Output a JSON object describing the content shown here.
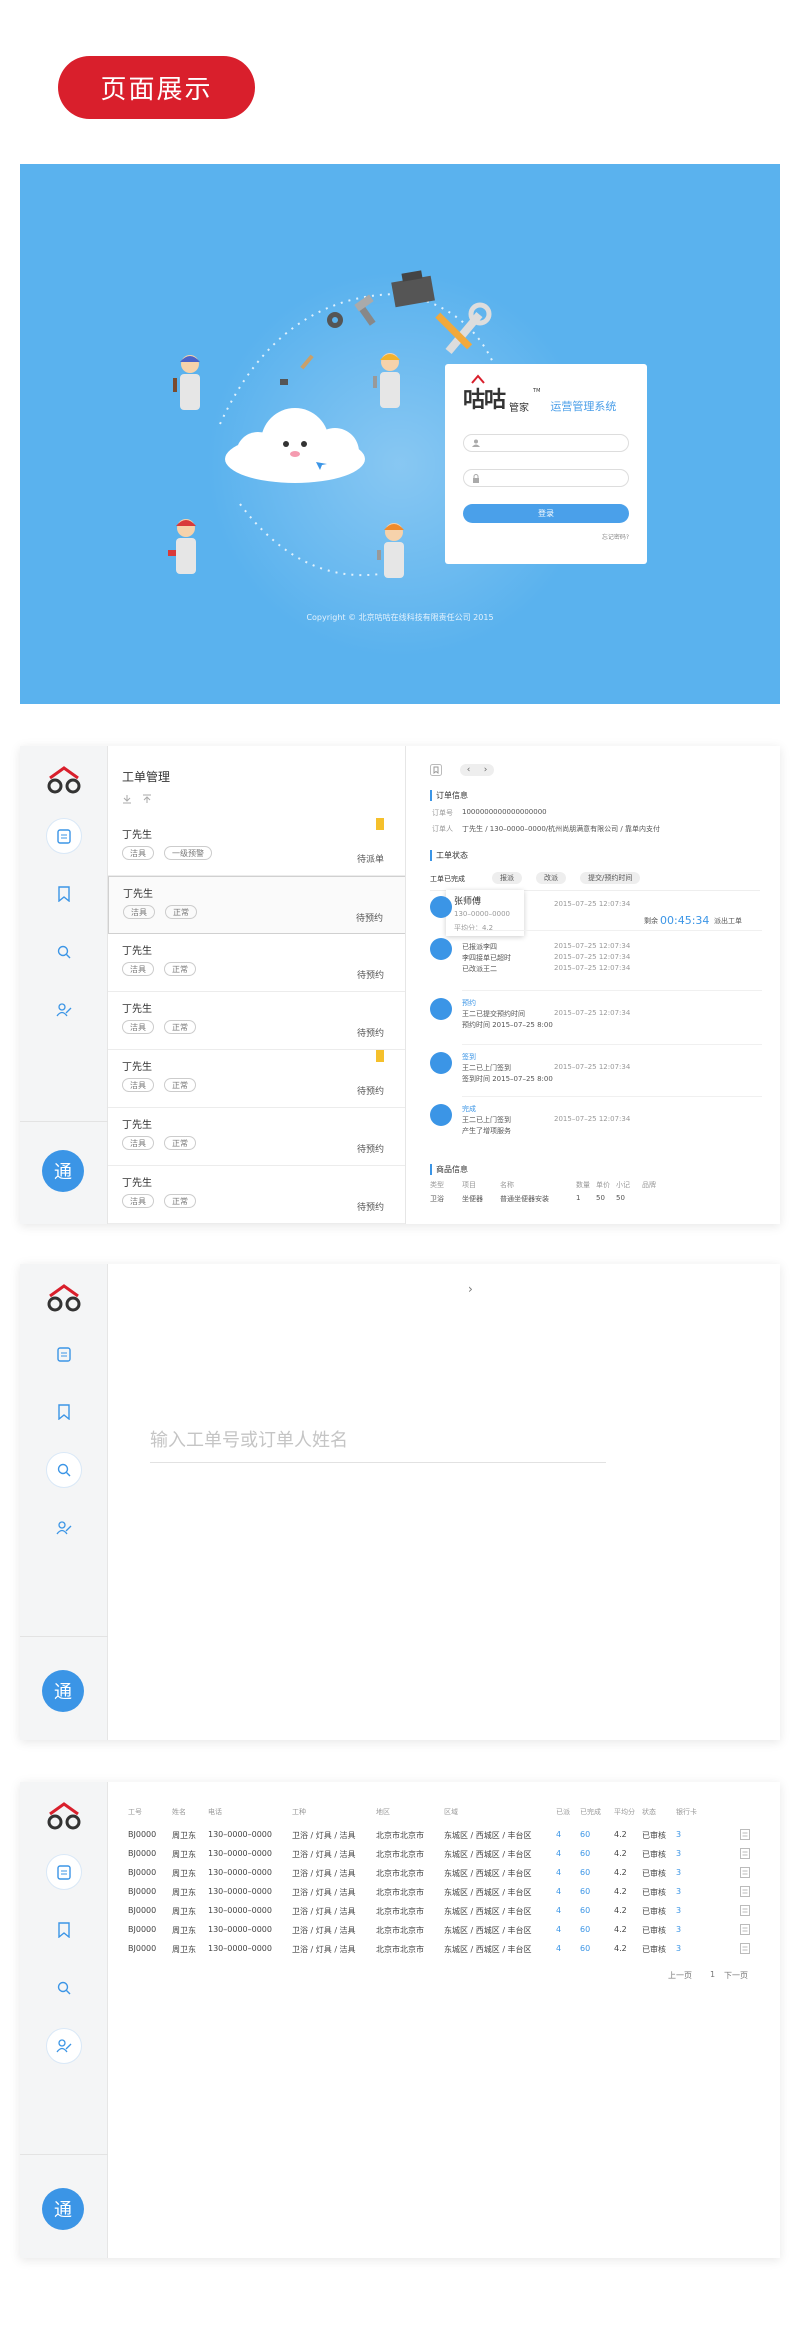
{
  "header": {
    "title": "页面展示"
  },
  "login": {
    "brand": "咕咕",
    "brand_sub": "管家",
    "tm": "TM",
    "system_name": "运营管理系统",
    "login_button": "登录",
    "forgot": "忘记密码?",
    "copyright": "Copyright © 北京咕咕在线科技有限责任公司 2015"
  },
  "sidebar": {
    "tong": "通"
  },
  "workorders": {
    "title": "工单管理",
    "items": [
      {
        "name": "丁先生",
        "tag1": "洁具",
        "tag2": "一级预警",
        "status": "待派单",
        "bookmark": true
      },
      {
        "name": "丁先生",
        "tag1": "洁具",
        "tag2": "正常",
        "status": "待预约",
        "bookmark": false
      },
      {
        "name": "丁先生",
        "tag1": "洁具",
        "tag2": "正常",
        "status": "待预约",
        "bookmark": false
      },
      {
        "name": "丁先生",
        "tag1": "洁具",
        "tag2": "正常",
        "status": "待预约",
        "bookmark": false
      },
      {
        "name": "丁先生",
        "tag1": "洁具",
        "tag2": "正常",
        "status": "待预约",
        "bookmark": true
      },
      {
        "name": "丁先生",
        "tag1": "洁具",
        "tag2": "正常",
        "status": "待预约",
        "bookmark": false
      },
      {
        "name": "丁先生",
        "tag1": "洁具",
        "tag2": "正常",
        "status": "待预约",
        "bookmark": false
      }
    ]
  },
  "detail": {
    "order_info_title": "订单信息",
    "order_no_label": "订单号",
    "order_no": "1000000000000000000",
    "customer_label": "订单人",
    "customer": "丁先生 / 130–0000–0000/杭州尚朋满意有限公司 / 靠单内支付",
    "status_title": "工单状态",
    "tabs": [
      "工单已完成",
      "报派",
      "改派",
      "提交/预约时间"
    ],
    "popup": {
      "name": "张师傅",
      "phone": "130–0000–0000",
      "score": "平均分：4.2"
    },
    "remain_label": "剩余",
    "remain_time": "00:45:34",
    "remain_suffix": "派出工单",
    "timeline": [
      {
        "lines": [
          {
            "text": "",
            "time": "2015–07–25 12:07:34"
          }
        ]
      },
      {
        "lines": [
          {
            "text": "已报派李四",
            "time": "2015–07–25 12:07:34"
          },
          {
            "text": "李四接单已超时",
            "time": "2015–07–25 12:07:34"
          },
          {
            "text": "已改派王二",
            "time": "2015–07–25 12:07:34"
          }
        ]
      },
      {
        "title": "预约",
        "lines": [
          {
            "text": "王二已提交预约时间",
            "time": "2015–07–25 12:07:34"
          },
          {
            "text": "预约时间 2015–07–25 8:00",
            "time": ""
          }
        ]
      },
      {
        "title": "签到",
        "lines": [
          {
            "text": "王二已上门签到",
            "time": "2015–07–25 12:07:34"
          },
          {
            "text": "签到时间 2015–07–25 8:00",
            "time": ""
          }
        ]
      },
      {
        "title": "完成",
        "lines": [
          {
            "text": "王二已上门签到",
            "time": "2015–07–25 12:07:34"
          },
          {
            "text": "产生了增项服务",
            "time": ""
          }
        ]
      }
    ],
    "goods_title": "商品信息",
    "goods_headers": [
      "类型",
      "项目",
      "名称",
      "数量",
      "单价",
      "小记",
      "品牌"
    ],
    "goods_row": [
      "卫浴",
      "坐便器",
      "普通坐便器安装",
      "1",
      "50",
      "50",
      ""
    ]
  },
  "search": {
    "placeholder": "输入工单号或订单人姓名",
    "chevron": "›"
  },
  "table": {
    "headers": [
      "工号",
      "姓名",
      "电话",
      "工种",
      "地区",
      "区域",
      "已派",
      "已完成",
      "平均分",
      "状态",
      "银行卡"
    ],
    "rows": [
      [
        "BJ0000",
        "周卫东",
        "130–0000–0000",
        "卫浴 / 灯具 / 洁具",
        "北京市北京市",
        "东城区 / 西城区 / 丰台区",
        "4",
        "60",
        "4.2",
        "已审核",
        "3"
      ],
      [
        "BJ0000",
        "周卫东",
        "130–0000–0000",
        "卫浴 / 灯具 / 洁具",
        "北京市北京市",
        "东城区 / 西城区 / 丰台区",
        "4",
        "60",
        "4.2",
        "已审核",
        "3"
      ],
      [
        "BJ0000",
        "周卫东",
        "130–0000–0000",
        "卫浴 / 灯具 / 洁具",
        "北京市北京市",
        "东城区 / 西城区 / 丰台区",
        "4",
        "60",
        "4.2",
        "已审核",
        "3"
      ],
      [
        "BJ0000",
        "周卫东",
        "130–0000–0000",
        "卫浴 / 灯具 / 洁具",
        "北京市北京市",
        "东城区 / 西城区 / 丰台区",
        "4",
        "60",
        "4.2",
        "已审核",
        "3"
      ],
      [
        "BJ0000",
        "周卫东",
        "130–0000–0000",
        "卫浴 / 灯具 / 洁具",
        "北京市北京市",
        "东城区 / 西城区 / 丰台区",
        "4",
        "60",
        "4.2",
        "已审核",
        "3"
      ],
      [
        "BJ0000",
        "周卫东",
        "130–0000–0000",
        "卫浴 / 灯具 / 洁具",
        "北京市北京市",
        "东城区 / 西城区 / 丰台区",
        "4",
        "60",
        "4.2",
        "已审核",
        "3"
      ],
      [
        "BJ0000",
        "周卫东",
        "130–0000–0000",
        "卫浴 / 灯具 / 洁具",
        "北京市北京市",
        "东城区 / 西城区 / 丰台区",
        "4",
        "60",
        "4.2",
        "已审核",
        "3"
      ]
    ],
    "pager": {
      "prev": "上一页",
      "page": "1",
      "next": "下一页"
    }
  },
  "colors": {
    "accent": "#3b95e6",
    "brand_red": "#d91f2c",
    "login_bg": "#5ab2ee",
    "bookmark": "#f5c02b"
  }
}
